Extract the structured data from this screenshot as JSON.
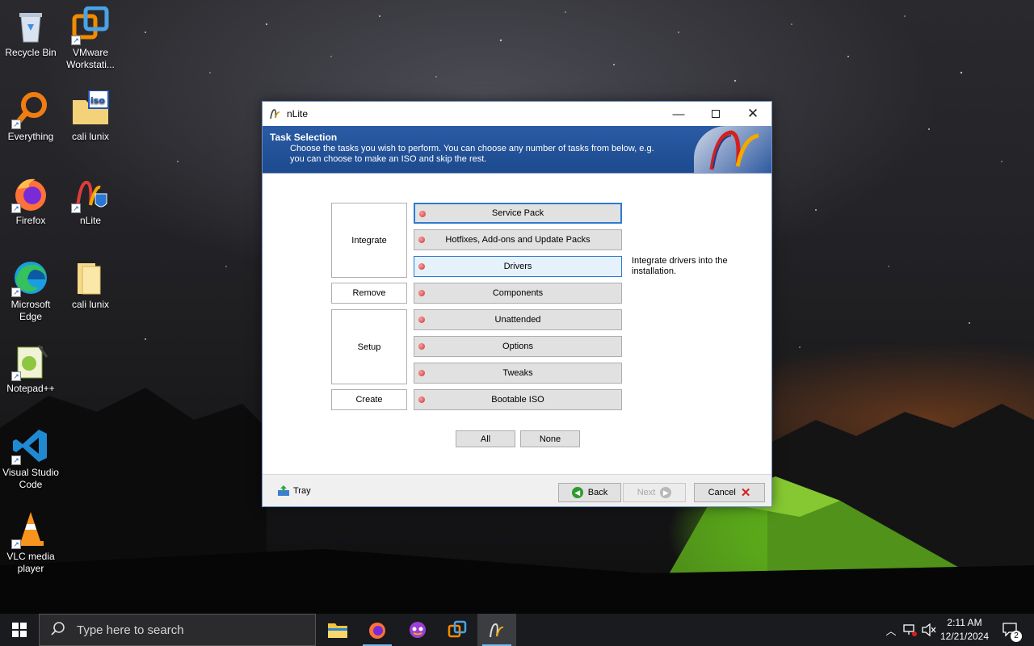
{
  "desktop": {
    "icons": [
      {
        "label": "Recycle Bin"
      },
      {
        "label": "VMware Workstati..."
      },
      {
        "label": "Everything"
      },
      {
        "label": "cali lunix"
      },
      {
        "label": "Firefox"
      },
      {
        "label": "nLite"
      },
      {
        "label": "Microsoft Edge"
      },
      {
        "label": "cali lunix"
      },
      {
        "label": "Notepad++"
      },
      {
        "label": "Visual Studio Code"
      },
      {
        "label": "VLC media player"
      }
    ]
  },
  "window": {
    "title": "nLite",
    "header": {
      "title": "Task Selection",
      "description": "Choose the tasks you wish to perform. You can choose any number of tasks from below, e.g. you can choose to make an ISO and skip the rest."
    },
    "categories": [
      "Integrate",
      "Remove",
      "Setup",
      "Create"
    ],
    "tasks": [
      {
        "label": "Service Pack"
      },
      {
        "label": "Hotfixes, Add-ons and Update Packs"
      },
      {
        "label": "Drivers"
      },
      {
        "label": "Components"
      },
      {
        "label": "Unattended"
      },
      {
        "label": "Options"
      },
      {
        "label": "Tweaks"
      },
      {
        "label": "Bootable ISO"
      }
    ],
    "hint": "Integrate drivers into the installation.",
    "select_all": "All",
    "select_none": "None",
    "footer": {
      "tray": "Tray",
      "back": "Back",
      "next": "Next",
      "cancel": "Cancel"
    }
  },
  "taskbar": {
    "search_placeholder": "Type here to search",
    "time": "2:11 AM",
    "date": "12/21/2024",
    "notification_count": "2"
  },
  "colors": {
    "header_blue": "#1d4a8e",
    "accent": "#2f7ad1",
    "tent_green": "#7fd02a"
  }
}
